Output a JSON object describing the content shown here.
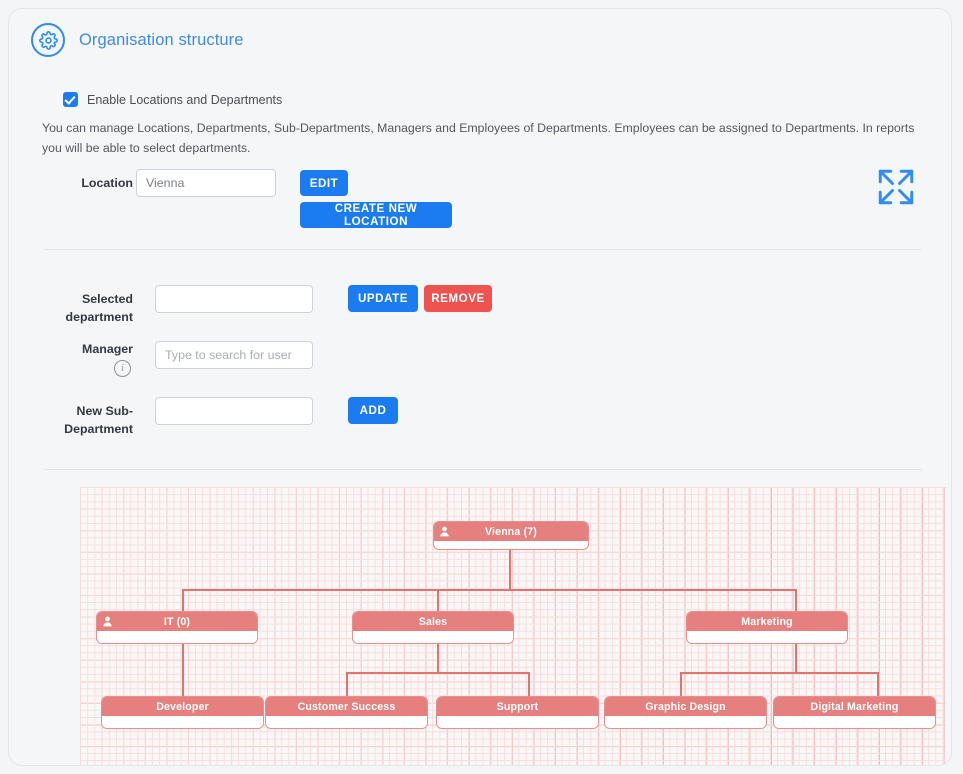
{
  "header": {
    "title": "Organisation structure",
    "icon": "gear-icon"
  },
  "enable_toggle": {
    "label": "Enable Locations and Departments",
    "checked": true
  },
  "description": "You can manage Locations, Departments, Sub-Departments, Managers and Employees of Departments. Employees can be assigned to Departments. In reports you will be able to select departments.",
  "location_row": {
    "label": "Location",
    "value": "Vienna",
    "edit_label": "EDIT",
    "create_label": "CREATE NEW LOCATION",
    "expand_icon": "expand-arrows-icon"
  },
  "selected_department_row": {
    "label": "Selected department",
    "value": "",
    "placeholder": "",
    "update_label": "UPDATE",
    "remove_label": "REMOVE"
  },
  "manager_row": {
    "label": "Manager",
    "value": "",
    "placeholder": "Type to search for user",
    "info_icon": "info-icon",
    "info_glyph": "i"
  },
  "new_sub_department_row": {
    "label": "New Sub-Department",
    "value": "",
    "placeholder": "",
    "add_label": "ADD"
  },
  "colors": {
    "accent_blue": "#1a7cf0",
    "title_blue": "#3f8ae8",
    "danger_red": "#ef5350",
    "node_header_red": "#e5807e",
    "node_border_red": "#e98e8e",
    "connector_red": "#e1746f",
    "grid_line_light": "#f6dede",
    "grid_line_dark": "#f0b9b9",
    "card_bg": "#f5f6f7"
  },
  "org_chart": {
    "type": "tree",
    "nodes": [
      {
        "id": "vienna",
        "label": "Vienna (7)",
        "count": 7,
        "has_person_icon": true,
        "level": 0
      },
      {
        "id": "it",
        "label": "IT (0)",
        "count": 0,
        "has_person_icon": true,
        "level": 1
      },
      {
        "id": "sales",
        "label": "Sales",
        "count": null,
        "has_person_icon": false,
        "level": 1
      },
      {
        "id": "marketing",
        "label": "Marketing",
        "count": null,
        "has_person_icon": false,
        "level": 1
      },
      {
        "id": "developer",
        "label": "Developer",
        "count": null,
        "has_person_icon": false,
        "level": 2
      },
      {
        "id": "customer-success",
        "label": "Customer Success",
        "count": null,
        "has_person_icon": false,
        "level": 2
      },
      {
        "id": "support",
        "label": "Support",
        "count": null,
        "has_person_icon": false,
        "level": 2
      },
      {
        "id": "graphic-design",
        "label": "Graphic Design",
        "count": null,
        "has_person_icon": false,
        "level": 2
      },
      {
        "id": "digital-marketing",
        "label": "Digital Marketing",
        "count": null,
        "has_person_icon": false,
        "level": 2
      }
    ],
    "edges": [
      {
        "from": "vienna",
        "to": "it"
      },
      {
        "from": "vienna",
        "to": "sales"
      },
      {
        "from": "vienna",
        "to": "marketing"
      },
      {
        "from": "it",
        "to": "developer"
      },
      {
        "from": "sales",
        "to": "customer-success"
      },
      {
        "from": "sales",
        "to": "support"
      },
      {
        "from": "marketing",
        "to": "graphic-design"
      },
      {
        "from": "marketing",
        "to": "digital-marketing"
      }
    ]
  }
}
